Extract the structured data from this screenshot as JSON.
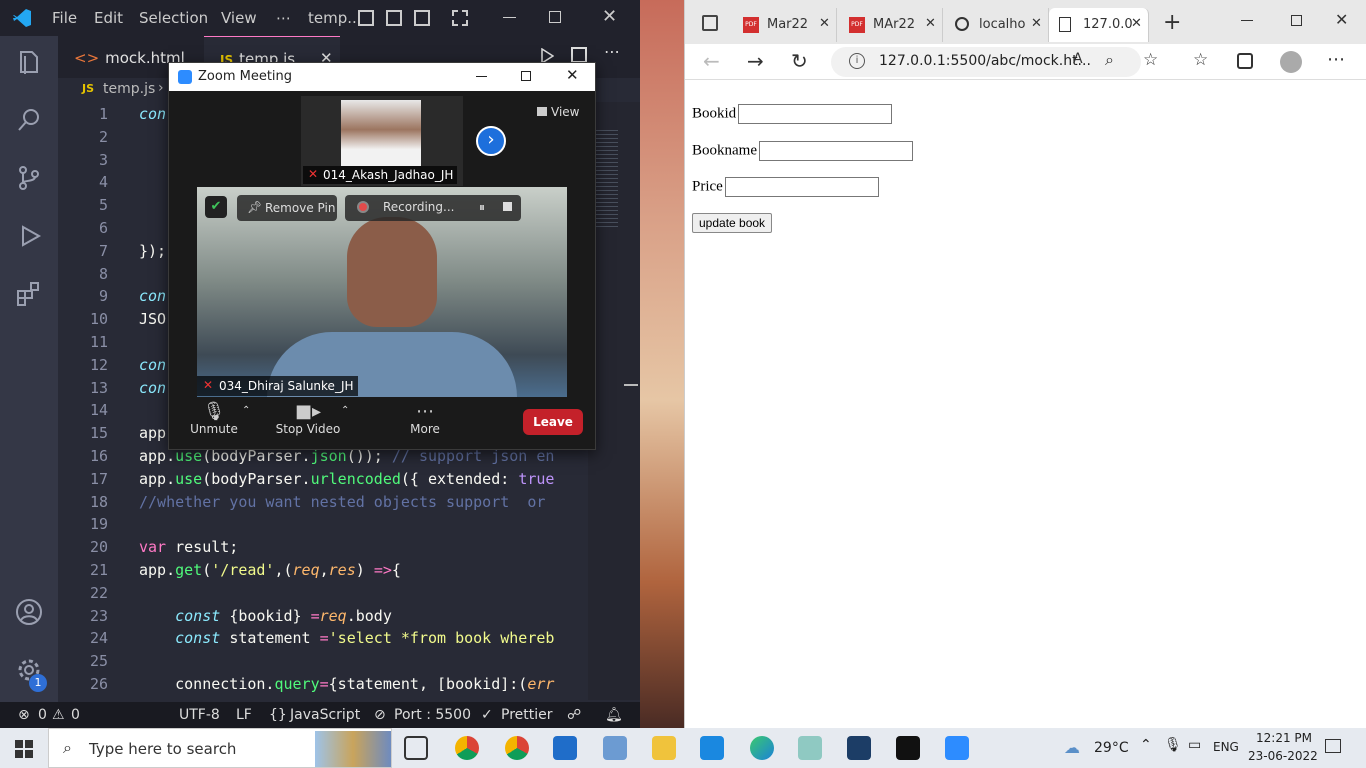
{
  "vscode": {
    "menu": [
      "File",
      "Edit",
      "Selection",
      "View",
      "⋯",
      "temp..."
    ],
    "tabs": [
      "mock.html",
      "temp.js"
    ],
    "breadcrumb": "temp.js",
    "line_numbers": [
      "1",
      "2",
      "3",
      "4",
      "5",
      "6",
      "7",
      "8",
      "9",
      "10",
      "11",
      "12",
      "13",
      "14",
      "15",
      "16",
      "17",
      "18",
      "19",
      "20",
      "21",
      "22",
      "23",
      "24",
      "25",
      "26"
    ],
    "code_lines": [
      {
        "n": 1,
        "parts": [
          {
            "t": "con",
            "c": "kw"
          }
        ]
      },
      {
        "n": 7,
        "parts": [
          {
            "t": "});",
            "c": ""
          }
        ]
      },
      {
        "n": 9,
        "parts": [
          {
            "t": "con",
            "c": "kw"
          }
        ]
      },
      {
        "n": 10,
        "parts": [
          {
            "t": "JSO",
            "c": ""
          }
        ]
      },
      {
        "n": 12,
        "parts": [
          {
            "t": "con",
            "c": "kw"
          }
        ]
      },
      {
        "n": 13,
        "parts": [
          {
            "t": "con",
            "c": "kw"
          }
        ]
      },
      {
        "n": 15,
        "parts": [
          {
            "t": "app",
            "c": ""
          }
        ]
      },
      {
        "n": 16,
        "parts": [
          {
            "t": "app.",
            "c": ""
          },
          {
            "t": "use",
            "c": "fn"
          },
          {
            "t": "(bodyParser.",
            "c": ""
          },
          {
            "t": "json",
            "c": "fn"
          },
          {
            "t": "()); ",
            "c": ""
          },
          {
            "t": "// support json en",
            "c": "cm"
          }
        ]
      },
      {
        "n": 17,
        "parts": [
          {
            "t": "app.",
            "c": ""
          },
          {
            "t": "use",
            "c": "fn"
          },
          {
            "t": "(bodyParser.",
            "c": ""
          },
          {
            "t": "urlencoded",
            "c": "fn"
          },
          {
            "t": "({ extended: ",
            "c": ""
          },
          {
            "t": "true",
            "c": "bl"
          }
        ]
      },
      {
        "n": 18,
        "parts": [
          {
            "t": "//whether you want nested objects support  or",
            "c": "cm"
          }
        ]
      },
      {
        "n": 20,
        "parts": [
          {
            "t": "var ",
            "c": "pk"
          },
          {
            "t": "result;",
            "c": ""
          }
        ]
      },
      {
        "n": 21,
        "parts": [
          {
            "t": "app.",
            "c": ""
          },
          {
            "t": "get",
            "c": "fn"
          },
          {
            "t": "(",
            "c": ""
          },
          {
            "t": "'/read'",
            "c": "st"
          },
          {
            "t": ",(",
            "c": ""
          },
          {
            "t": "req",
            "c": "pa"
          },
          {
            "t": ",",
            "c": ""
          },
          {
            "t": "res",
            "c": "pa"
          },
          {
            "t": ") ",
            "c": ""
          },
          {
            "t": "=>",
            "c": "pk"
          },
          {
            "t": "{",
            "c": ""
          }
        ]
      },
      {
        "n": 23,
        "parts": [
          {
            "t": "    ",
            "c": ""
          },
          {
            "t": "const ",
            "c": "kw"
          },
          {
            "t": "{bookid} ",
            "c": ""
          },
          {
            "t": "=",
            "c": "pk"
          },
          {
            "t": "req",
            "c": "pa"
          },
          {
            "t": ".body",
            "c": ""
          }
        ]
      },
      {
        "n": 24,
        "parts": [
          {
            "t": "    ",
            "c": ""
          },
          {
            "t": "const ",
            "c": "kw"
          },
          {
            "t": "statement ",
            "c": ""
          },
          {
            "t": "=",
            "c": "pk"
          },
          {
            "t": "'select *from book whereb",
            "c": "st"
          }
        ]
      },
      {
        "n": 26,
        "parts": [
          {
            "t": "    connection.",
            "c": ""
          },
          {
            "t": "query",
            "c": "fn"
          },
          {
            "t": "=",
            "c": "pk"
          },
          {
            "t": "{statement, [bookid]:(",
            "c": ""
          },
          {
            "t": "err",
            "c": "pa"
          }
        ]
      }
    ],
    "status": {
      "errors": "0",
      "warnings": "0",
      "encoding": "UTF-8",
      "eol": "LF",
      "language": "JavaScript",
      "port": "Port : 5500",
      "prettier": "Prettier",
      "badge": "1"
    }
  },
  "zoom": {
    "title": "Zoom Meeting",
    "view_label": "View",
    "self_name": "014_Akash_Jadhao_JH",
    "main_name": "034_Dhiraj Salunke_JH",
    "remove_pin": "Remove Pin",
    "recording": "Recording...",
    "unmute": "Unmute",
    "stop_video": "Stop Video",
    "more": "More",
    "leave": "Leave"
  },
  "browser": {
    "tabs": [
      "Mar22",
      "MAr22",
      "localho",
      "127.0.0"
    ],
    "url": "127.0.0.1:5500/abc/mock.ht...",
    "form": {
      "bookid_label": "Bookid",
      "bookname_label": "Bookname",
      "price_label": "Price",
      "button": "update book"
    }
  },
  "taskbar": {
    "search_placeholder": "Type here to search",
    "weather": "29°C",
    "lang": "ENG",
    "time": "12:21 PM",
    "date": "23-06-2022"
  }
}
